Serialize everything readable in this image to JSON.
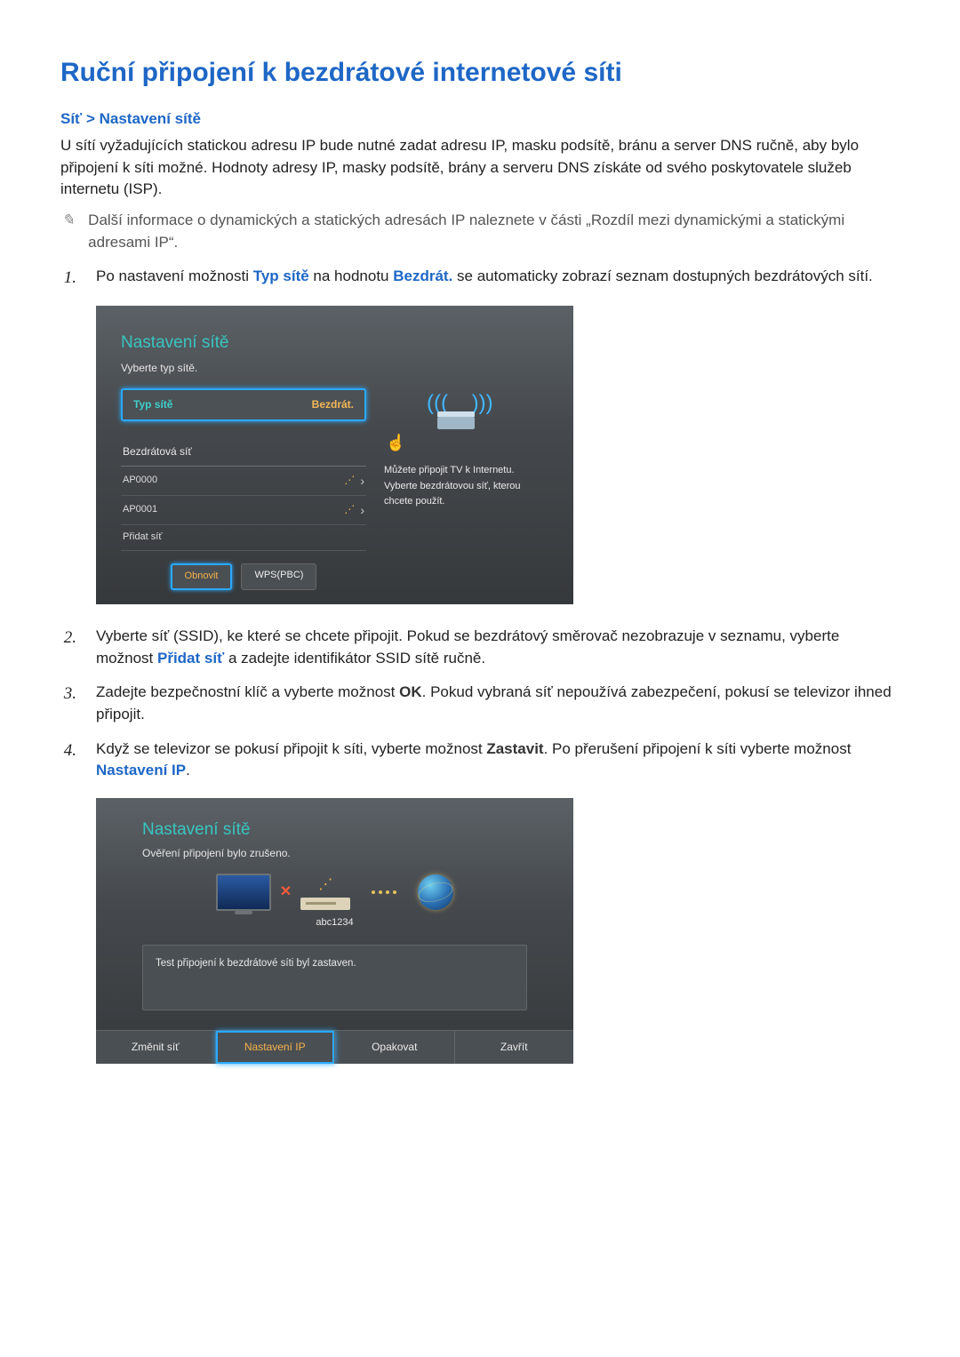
{
  "heading": "Ruční připojení k bezdrátové internetové síti",
  "breadcrumb": {
    "a": "Síť",
    "sep": " > ",
    "b": "Nastavení sítě"
  },
  "intro": "U sítí vyžadujících statickou adresu IP bude nutné zadat adresu IP, masku podsítě, bránu a server DNS ručně, aby bylo připojení k síti možné. Hodnoty adresy IP, masky podsítě, brány a serveru DNS získáte od svého poskytovatele služeb internetu (ISP).",
  "note": "Další informace o dynamických a statických adresách IP naleznete v části „Rozdíl mezi dynamickými a statickými adresami IP“.",
  "steps": {
    "s1a": "Po nastavení možnosti ",
    "s1kw1": "Typ sítě",
    "s1b": " na hodnotu ",
    "s1kw2": "Bezdrát.",
    "s1c": " se automaticky zobrazí seznam dostupných bezdrátových sítí.",
    "s2a": "Vyberte síť (SSID), ke které se chcete připojit. Pokud se bezdrátový směrovač nezobrazuje v seznamu, vyberte možnost ",
    "s2kw": "Přidat síť",
    "s2b": " a zadejte identifikátor SSID sítě ručně.",
    "s3a": "Zadejte bezpečnostní klíč a vyberte možnost ",
    "s3kw": "OK",
    "s3b": ". Pokud vybraná síť nepoužívá zabezpečení, pokusí se televizor ihned připojit.",
    "s4a": "Když se televizor se pokusí připojit k síti, vyberte možnost ",
    "s4kw1": "Zastavit",
    "s4b": ". Po přerušení připojení k síti vyberte možnost ",
    "s4kw2": "Nastavení IP",
    "s4c": "."
  },
  "tv1": {
    "title": "Nastavení sítě",
    "sub": "Vyberte typ sítě.",
    "sel_label": "Typ sítě",
    "sel_value": "Bezdrát.",
    "list_head": "Bezdrátová síť",
    "items": [
      "AP0000",
      "AP0001",
      "Přidat síť"
    ],
    "btn_refresh": "Obnovit",
    "btn_wps": "WPS(PBC)",
    "right1": "Můžete připojit TV k Internetu.",
    "right2": "Vyberte bezdrátovou síť, kterou",
    "right3": "chcete použít."
  },
  "tv2": {
    "title": "Nastavení sítě",
    "sub": "Ověření připojení bylo zrušeno.",
    "ssid": "abc1234",
    "msg": "Test připojení k bezdrátové síti byl zastaven.",
    "btns": [
      "Změnit síť",
      "Nastavení IP",
      "Opakovat",
      "Zavřít"
    ],
    "hl_index": 1
  }
}
